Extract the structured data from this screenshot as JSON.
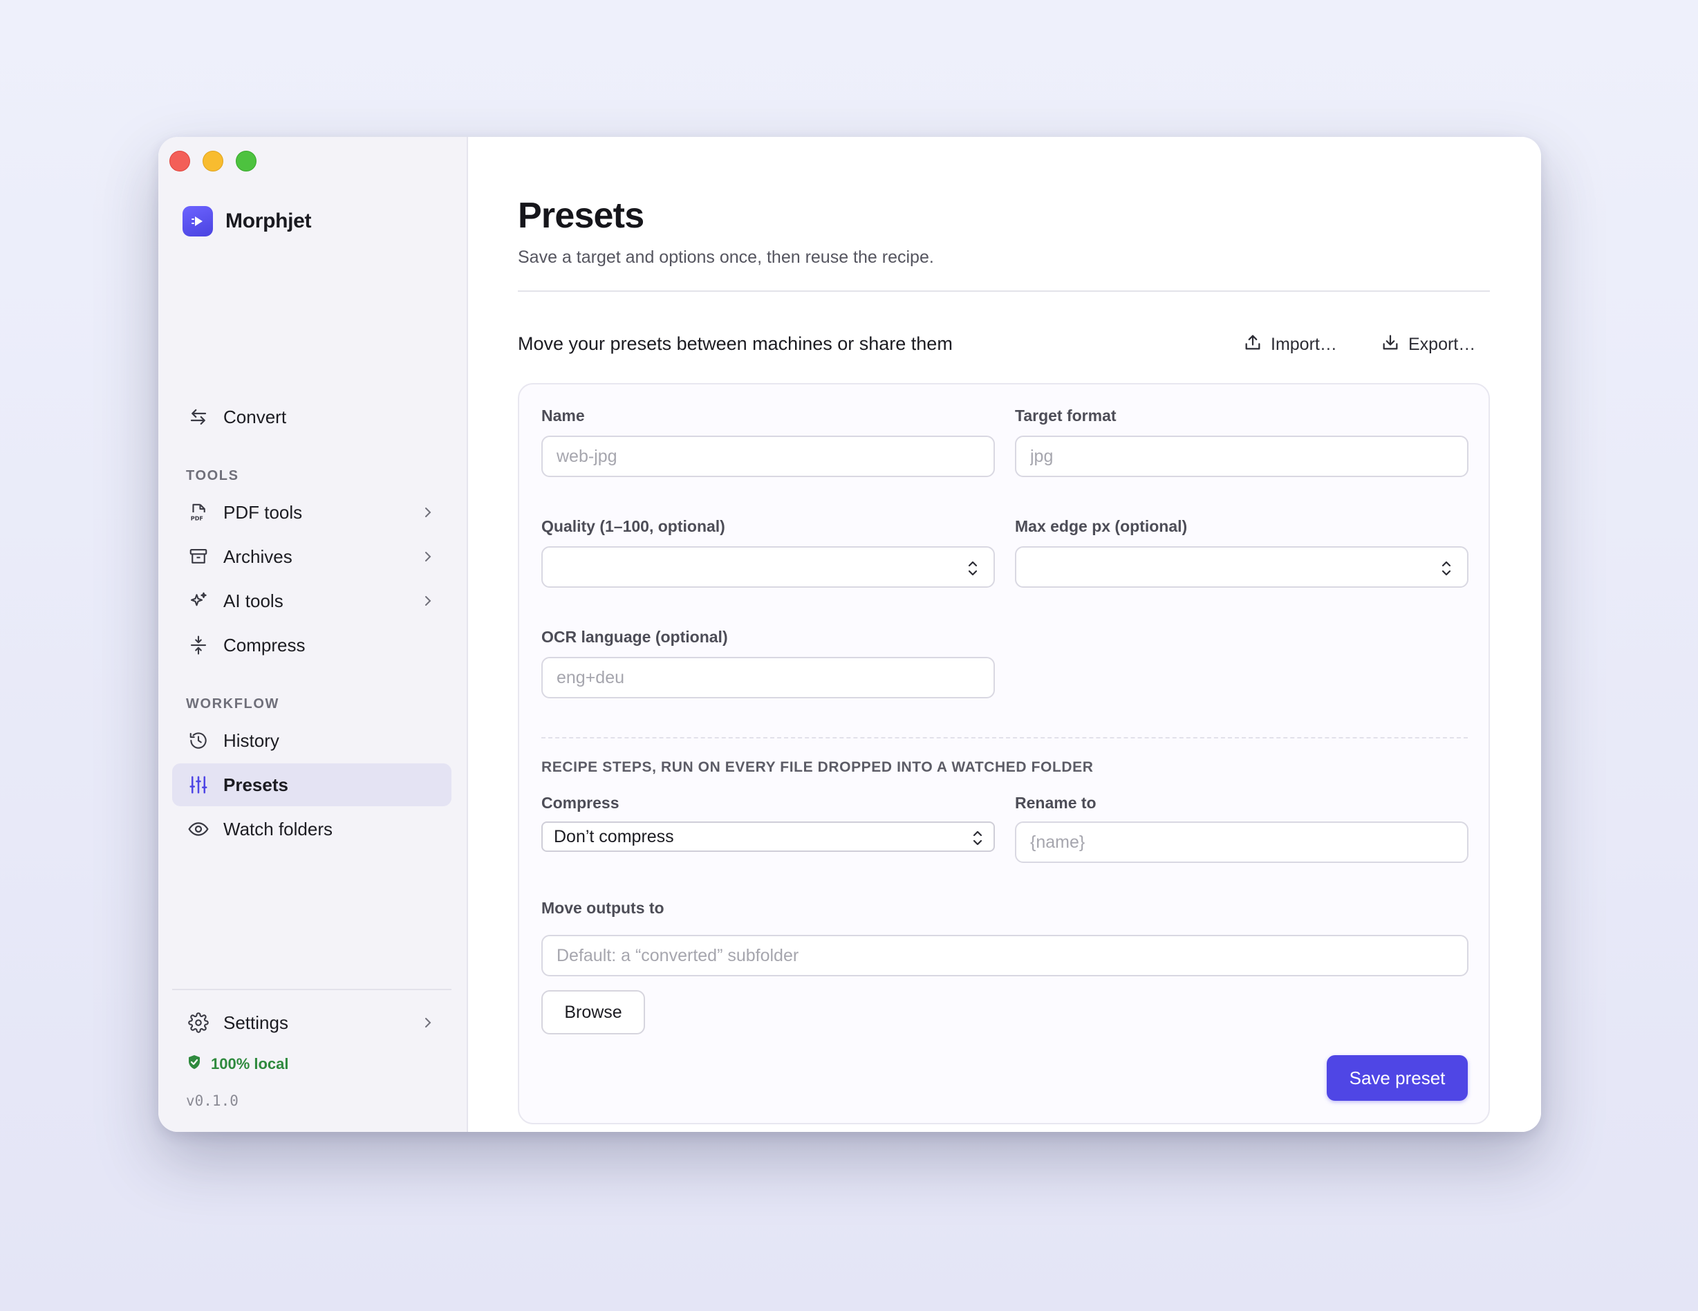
{
  "app": {
    "name": "Morphjet",
    "version": "v0.1.0",
    "badge": "100% local"
  },
  "sidebar": {
    "convert": {
      "label": "Convert",
      "icon": "convert-arrows-icon"
    },
    "tools_heading": "TOOLS",
    "tools": [
      {
        "label": "PDF tools",
        "icon": "pdf-file-icon",
        "has_submenu": true
      },
      {
        "label": "Archives",
        "icon": "archive-box-icon",
        "has_submenu": true
      },
      {
        "label": "AI tools",
        "icon": "sparkles-icon",
        "has_submenu": true
      },
      {
        "label": "Compress",
        "icon": "compress-icon",
        "has_submenu": false
      }
    ],
    "workflow_heading": "WORKFLOW",
    "workflow": [
      {
        "label": "History",
        "icon": "history-icon",
        "active": false
      },
      {
        "label": "Presets",
        "icon": "sliders-icon",
        "active": true
      },
      {
        "label": "Watch folders",
        "icon": "eye-icon",
        "active": false
      }
    ],
    "settings": {
      "label": "Settings",
      "icon": "gear-icon"
    }
  },
  "page": {
    "title": "Presets",
    "subtitle": "Save a target and options once, then reuse the recipe.",
    "share_text": "Move your presets between machines or share them",
    "import_label": "Import…",
    "export_label": "Export…"
  },
  "form": {
    "name": {
      "label": "Name",
      "placeholder": "web-jpg",
      "value": ""
    },
    "target_format": {
      "label": "Target format",
      "placeholder": "jpg",
      "value": ""
    },
    "quality": {
      "label": "Quality (1–100, optional)",
      "value": ""
    },
    "max_edge": {
      "label": "Max edge px (optional)",
      "value": ""
    },
    "ocr": {
      "label": "OCR language (optional)",
      "placeholder": "eng+deu",
      "value": ""
    },
    "recipe_heading": "RECIPE STEPS, RUN ON EVERY FILE DROPPED INTO A WATCHED FOLDER",
    "compress": {
      "label": "Compress",
      "selected": "Don’t compress"
    },
    "rename": {
      "label": "Rename to",
      "placeholder": "{name}",
      "value": ""
    },
    "move_outputs": {
      "label": "Move outputs to",
      "placeholder": "Default: a “converted” subfolder",
      "value": ""
    },
    "browse_label": "Browse",
    "save_label": "Save preset"
  },
  "colors": {
    "accent": "#4f46e5",
    "active_nav_bg": "#e4e3f3",
    "local_green": "#2f8a3e",
    "sidebar_bg": "#f4f3f8"
  }
}
